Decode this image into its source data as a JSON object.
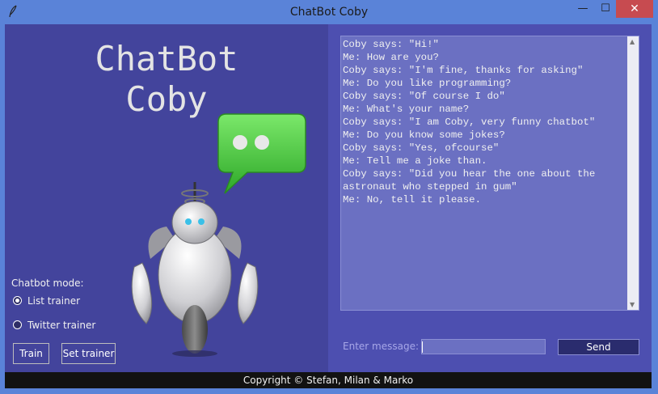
{
  "window": {
    "title": "ChatBot Coby",
    "min_glyph": "—",
    "max_glyph": "☐",
    "close_glyph": "✕",
    "app_icon": "feather-icon"
  },
  "left": {
    "headline_line1": "ChatBot",
    "headline_line2": "Coby",
    "illustration_icons": [
      "robot-icon",
      "speech-bubble-icon"
    ],
    "mode_label": "Chatbot mode:",
    "options": [
      {
        "label": "List trainer",
        "selected": true
      },
      {
        "label": "Twitter trainer",
        "selected": false
      }
    ],
    "train_button": "Train",
    "set_trainer_button": "Set trainer"
  },
  "chat": {
    "lines": [
      "Coby says: \"Hi!\"",
      "Me: How are you?",
      "Coby says: \"I'm fine, thanks for asking\"",
      "Me: Do you like programming?",
      "Coby says: \"Of course I do\"",
      "Me: What's your name?",
      "Coby says: \"I am Coby, very funny chatbot\"",
      "Me: Do you know some jokes?",
      "Coby says: \"Yes, ofcourse\"",
      "Me: Tell me a joke than.",
      "Coby says: \"Did you hear the one about the",
      "astronaut who stepped in gum\"",
      "Me: No, tell it please."
    ]
  },
  "input": {
    "label": "Enter message:",
    "value": "",
    "send_button": "Send"
  },
  "footer": {
    "text": "Copyright © Stefan, Milan & Marko"
  },
  "colors": {
    "left_panel": "#43449c",
    "right_panel": "#4d4fb0",
    "chat_bg": "#6b70c2",
    "bubble_green": "#4ccf3c",
    "close_red": "#c74b50"
  }
}
